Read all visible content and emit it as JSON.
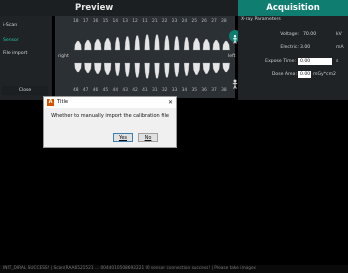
{
  "header": {
    "preview_tab": "Preview",
    "acquisition_tab": "Acquisition"
  },
  "sidebar": {
    "items": [
      {
        "label": "i-Scan"
      },
      {
        "label": "Sensor"
      },
      {
        "label": "File import"
      }
    ],
    "close_label": "Close"
  },
  "chart": {
    "upper_numbers": [
      "18",
      "17",
      "16",
      "15",
      "14",
      "13",
      "12",
      "11",
      "21",
      "22",
      "23",
      "24",
      "25",
      "26",
      "27",
      "28"
    ],
    "lower_numbers": [
      "48",
      "47",
      "46",
      "45",
      "44",
      "43",
      "42",
      "41",
      "31",
      "32",
      "33",
      "34",
      "35",
      "36",
      "37",
      "38"
    ],
    "right_label": "right",
    "left_label": "left"
  },
  "xray": {
    "title": "X-ray Parameters",
    "voltage_label": "Voltage:",
    "voltage_value": "70.00",
    "voltage_unit": "kV",
    "electric_label": "Electric:",
    "electric_value": "3.00",
    "electric_unit": "mA",
    "exposure_label": "Expose Time:",
    "exposure_value": "0.00",
    "exposure_unit": "s",
    "dose_label": "Dose Area:",
    "dose_value": "0.00",
    "dose_unit": "mGy*cm2"
  },
  "dialog": {
    "title": "Title",
    "message": "Whether to manually import the calibration file",
    "yes_label": "Yes",
    "no_label": "No",
    "close_glyph": "✕",
    "icon_glyph": "A"
  },
  "status": {
    "text": "INIT_DIRAL SUCCESS! | Scan(RAA6521521 ... 0044010508692221 I0 sensor connection success! | Please take images"
  },
  "icons": [
    "tooth-icon",
    "child-icon"
  ],
  "colors": {
    "accent": "#0f7d70",
    "sensor_text": "#29c3a8"
  }
}
